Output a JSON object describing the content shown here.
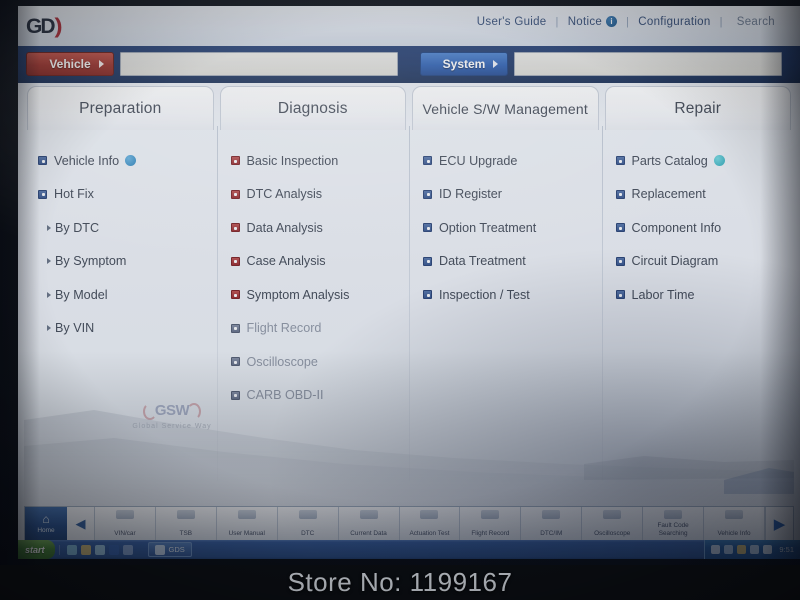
{
  "header": {
    "logo_text": "GD",
    "logo_swoosh": ")",
    "nav": {
      "users_guide": "User's Guide",
      "separator1": "|",
      "notice": "Notice",
      "notice_badge": "i",
      "separator2": "|",
      "configuration": "Configuration",
      "separator3": "|",
      "search": "Search"
    }
  },
  "selector": {
    "vehicle_label": "Vehicle",
    "vehicle_value": "",
    "system_label": "System",
    "system_value": ""
  },
  "columns": [
    {
      "title": "Preparation",
      "items": [
        {
          "label": "Vehicle Info",
          "bullet": "blue",
          "badge": "blue",
          "type": "item",
          "dim": false
        },
        {
          "label": "Hot Fix",
          "bullet": "blue",
          "badge": "",
          "type": "item",
          "dim": false
        },
        {
          "label": "By DTC",
          "bullet": "",
          "badge": "",
          "type": "sub",
          "dim": false
        },
        {
          "label": "By Symptom",
          "bullet": "",
          "badge": "",
          "type": "sub",
          "dim": false
        },
        {
          "label": "By Model",
          "bullet": "",
          "badge": "",
          "type": "sub",
          "dim": false
        },
        {
          "label": "By VIN",
          "bullet": "",
          "badge": "",
          "type": "sub",
          "dim": false
        }
      ]
    },
    {
      "title": "Diagnosis",
      "items": [
        {
          "label": "Basic Inspection",
          "bullet": "red",
          "badge": "",
          "type": "item",
          "dim": false
        },
        {
          "label": "DTC Analysis",
          "bullet": "red",
          "badge": "",
          "type": "item",
          "dim": false
        },
        {
          "label": "Data Analysis",
          "bullet": "red",
          "badge": "",
          "type": "item",
          "dim": false
        },
        {
          "label": "Case Analysis",
          "bullet": "red",
          "badge": "",
          "type": "item",
          "dim": false
        },
        {
          "label": "Symptom Analysis",
          "bullet": "red",
          "badge": "",
          "type": "item",
          "dim": false
        },
        {
          "label": "Flight Record",
          "bullet": "gray",
          "badge": "",
          "type": "item",
          "dim": true
        },
        {
          "label": "Oscilloscope",
          "bullet": "gray",
          "badge": "",
          "type": "item",
          "dim": true
        },
        {
          "label": "CARB OBD-II",
          "bullet": "gray",
          "badge": "",
          "type": "item",
          "dim": true
        }
      ]
    },
    {
      "title": "Vehicle S/W Management",
      "items": [
        {
          "label": "ECU Upgrade",
          "bullet": "blue",
          "badge": "",
          "type": "item",
          "dim": false
        },
        {
          "label": "ID Register",
          "bullet": "blue",
          "badge": "",
          "type": "item",
          "dim": false
        },
        {
          "label": "Option Treatment",
          "bullet": "blue",
          "badge": "",
          "type": "item",
          "dim": false
        },
        {
          "label": "Data Treatment",
          "bullet": "blue",
          "badge": "",
          "type": "item",
          "dim": false
        },
        {
          "label": "Inspection / Test",
          "bullet": "blue",
          "badge": "",
          "type": "item",
          "dim": false
        }
      ]
    },
    {
      "title": "Repair",
      "items": [
        {
          "label": "Parts Catalog",
          "bullet": "blue",
          "badge": "teal",
          "type": "item",
          "dim": false
        },
        {
          "label": "Replacement",
          "bullet": "blue",
          "badge": "",
          "type": "item",
          "dim": false
        },
        {
          "label": "Component Info",
          "bullet": "blue",
          "badge": "",
          "type": "item",
          "dim": false
        },
        {
          "label": "Circuit Diagram",
          "bullet": "blue",
          "badge": "",
          "type": "item",
          "dim": false
        },
        {
          "label": "Labor Time",
          "bullet": "blue",
          "badge": "",
          "type": "item",
          "dim": false
        }
      ]
    }
  ],
  "watermark": {
    "mark": "GSW",
    "subtitle": "Global Service Way"
  },
  "function_bar": {
    "home_label": "Home",
    "prev_arrow": "◀",
    "next_arrow": "▶",
    "items": [
      "VIN/car",
      "TSB",
      "User Manual",
      "DTC",
      "Current Data",
      "Actuation Test",
      "Flight Record",
      "DTC/IM",
      "Oscilloscope",
      "Fault Code Searching",
      "Vehicle Info"
    ]
  },
  "taskbar": {
    "start_label": "start",
    "task_label": "GDS",
    "tray_time": "9:51"
  },
  "caption": {
    "store_no": "Store No: 1199167"
  },
  "colors": {
    "accent_blue": "#1f5bbd",
    "vehicle_red": "#a82a22",
    "strip_navy": "#14326b",
    "badge_blue": "#1c7fc0",
    "badge_teal": "#1fa7bb"
  }
}
